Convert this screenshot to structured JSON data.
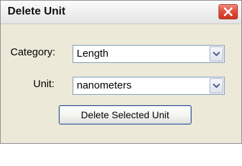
{
  "window": {
    "title": "Delete Unit",
    "close_icon": "close-x-icon"
  },
  "form": {
    "category_label": "Category:",
    "category_value": "Length",
    "unit_label": "Unit:",
    "unit_value": "nanometers",
    "dropdown_icon": "chevron-down-icon"
  },
  "actions": {
    "delete_label": "Delete Selected Unit"
  },
  "colors": {
    "close_button": "#df4d3a",
    "window_background": "#ece9d8",
    "field_border": "#7f9db9"
  }
}
